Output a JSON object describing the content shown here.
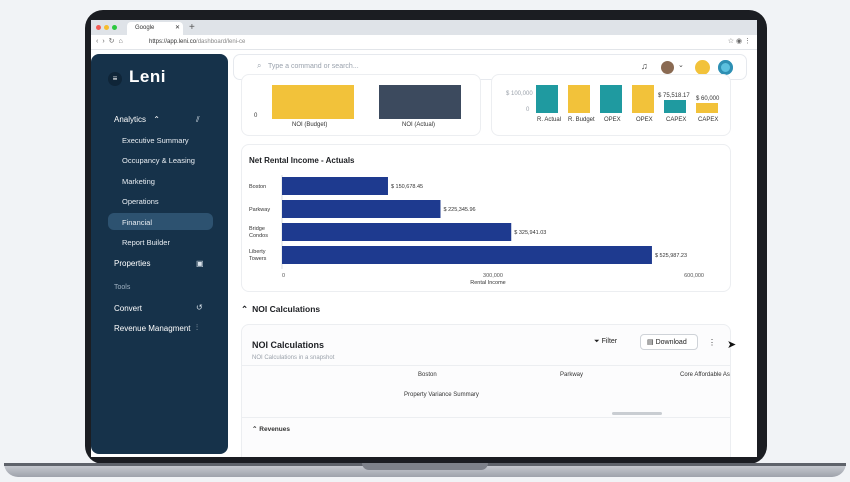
{
  "browser": {
    "tab_title": "Google",
    "url_host": "https://app.leni.co",
    "url_path": "/dashboard/leni-ce"
  },
  "sidebar": {
    "logo": "Leni",
    "sections": [
      {
        "label": "Analytics",
        "chevron": "^",
        "icon": "chart-icon"
      },
      {
        "label": "Properties",
        "icon": "building-icon"
      },
      {
        "label": "Convert",
        "icon": "refresh-icon"
      },
      {
        "label": "Revenue Managment",
        "icon": "sliders-icon"
      }
    ],
    "analytics_items": [
      "Executive Summary",
      "Occupancy & Leasing",
      "Marketing",
      "Operations",
      "Financial",
      "Report Builder"
    ],
    "active_item": "Financial",
    "tools_label": "Tools"
  },
  "topbar": {
    "search_placeholder": "Type a command or search..."
  },
  "chart_data": [
    {
      "type": "bar",
      "categories": [
        "NOI (Budget)",
        "NOI (Actual)"
      ],
      "axis_zero": "0",
      "colors": [
        "#f2c23a",
        "#3c4a5e"
      ]
    },
    {
      "type": "bar",
      "categories": [
        "R. Actual",
        "R. Budget",
        "OPEX",
        "OPEX",
        "CAPEX",
        "CAPEX"
      ],
      "y_tick_labels": [
        "$ 100,000",
        "0"
      ],
      "data_labels": [
        "$ 75,518.17",
        "$ 60,000"
      ],
      "colors": [
        "#1f9aa0",
        "#f2c23a",
        "#1f9aa0",
        "#f2c23a",
        "#1f9aa0",
        "#f2c23a"
      ]
    },
    {
      "type": "bar",
      "orientation": "horizontal",
      "title": "Net Rental Income - Actuals",
      "categories": [
        "Boston",
        "Parkway",
        "Bridge Condos",
        "Liberty Towers"
      ],
      "values": [
        150678.45,
        225345.96,
        325941.03,
        525987.23
      ],
      "value_labels": [
        "$ 150,678.45",
        "$ 225,345.96",
        "$ 325,941.03",
        "$ 525,987.23"
      ],
      "xlim": [
        0,
        600000
      ],
      "x_tick_labels": [
        "0",
        "300,000",
        "600,000"
      ],
      "xlabel": "Rental Income",
      "color": "#1e3a8f"
    }
  ],
  "noi_section": {
    "toggle_label": "NOI Calculations",
    "card_title": "NOI Calculations",
    "card_subtitle": "NOI Calculations in a snapshot",
    "filter_label": "Filter",
    "download_label": "Download",
    "columns": [
      "Boston",
      "Parkway",
      "Core Affordable As"
    ],
    "row_label": "Property Variance Summary",
    "revenues_label": "Revenues"
  }
}
